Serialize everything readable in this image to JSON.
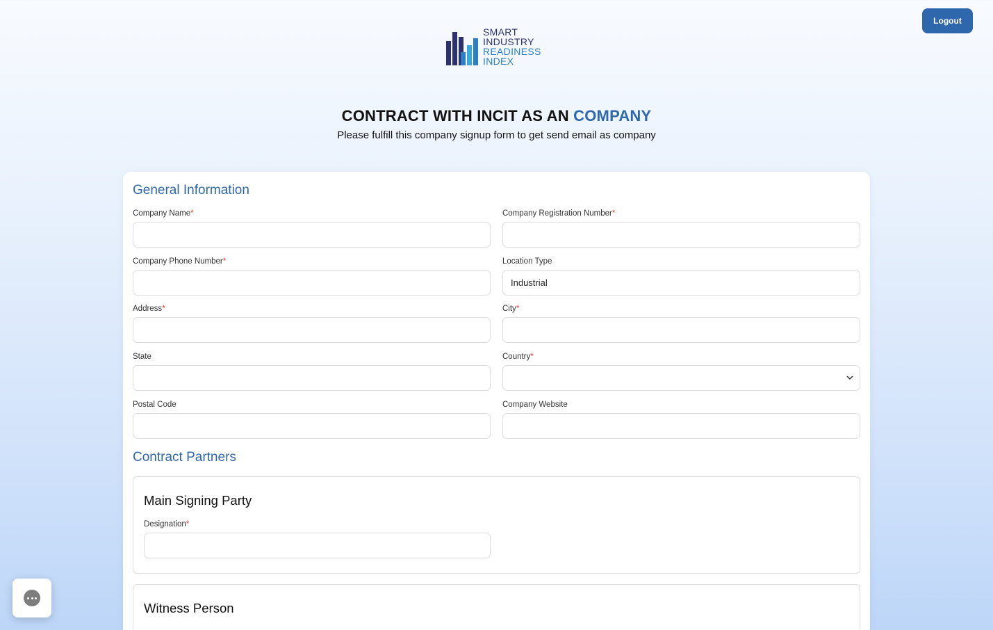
{
  "header": {
    "logout_label": "Logout",
    "logo": {
      "line1": "SMART",
      "line2": "INDUSTRY",
      "line3": "READINESS",
      "line4": "INDEX"
    },
    "title_main": "CONTRACT WITH INCIT AS AN ",
    "title_accent": "COMPANY",
    "subtitle": "Please fulfill this company signup form to get send email as company"
  },
  "general": {
    "section_title": "General Information",
    "company_name_label": "Company Name",
    "company_name_value": "",
    "registration_label": "Company Registration Number",
    "registration_value": "",
    "phone_label": "Company Phone Number",
    "phone_value": "",
    "location_type_label": "Location Type",
    "location_type_value": "Industrial",
    "address_label": "Address",
    "address_value": "",
    "city_label": "City",
    "city_value": "",
    "state_label": "State",
    "state_value": "",
    "country_label": "Country",
    "country_value": "",
    "postal_label": "Postal Code",
    "postal_value": "",
    "website_label": "Company Website",
    "website_value": "",
    "required_mark": "*"
  },
  "partners": {
    "section_title": "Contract Partners",
    "main_party_title": "Main Signing Party",
    "designation_label": "Designation",
    "designation_value": "",
    "witness_title": "Witness Person"
  },
  "colors": {
    "accent": "#2f67ad",
    "required": "#e53935"
  }
}
